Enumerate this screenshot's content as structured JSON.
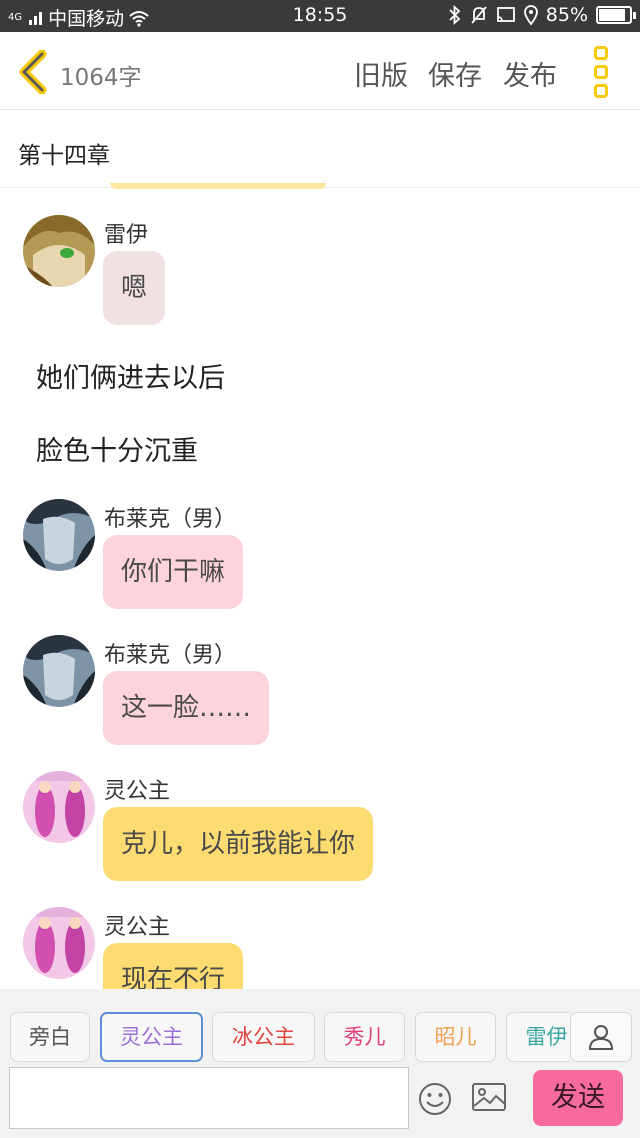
{
  "status_bar": {
    "signal": "4G",
    "carrier": "中国移动",
    "time": "18:55",
    "battery": "85%",
    "battery_level": 0.85
  },
  "header": {
    "word_count": "1064字",
    "old_version": "旧版",
    "save": "保存",
    "publish": "发布"
  },
  "chapter": {
    "title": "第十四章"
  },
  "messages": [
    {
      "type": "dialogue",
      "speaker": "雷伊",
      "text": "嗯",
      "bubble_color": "#f1e1e2"
    },
    {
      "type": "narration",
      "text": "她们俩进去以后"
    },
    {
      "type": "narration",
      "text": "脸色十分沉重"
    },
    {
      "type": "dialogue",
      "speaker": "布莱克（男）",
      "text": "你们干嘛",
      "bubble_color": "#fdd3dc"
    },
    {
      "type": "dialogue",
      "speaker": "布莱克（男）",
      "text": "这一脸……",
      "bubble_color": "#fdd3dc"
    },
    {
      "type": "dialogue",
      "speaker": "灵公主",
      "text": "克儿，以前我能让你",
      "bubble_color": "#fcdc70"
    },
    {
      "type": "dialogue",
      "speaker": "灵公主",
      "text": "现在不行",
      "bubble_color": "#fcdc70"
    }
  ],
  "roles": [
    {
      "name": "旁白",
      "color": "#555555",
      "selected": false
    },
    {
      "name": "灵公主",
      "color": "#9b6fd6",
      "selected": true
    },
    {
      "name": "冰公主",
      "color": "#e0443c",
      "selected": false
    },
    {
      "name": "秀儿",
      "color": "#e0407c",
      "selected": false
    },
    {
      "name": "昭儿",
      "color": "#f0a050",
      "selected": false
    },
    {
      "name": "雷伊",
      "color": "#3ba7a0",
      "selected": false
    }
  ],
  "input": {
    "value": "",
    "placeholder": ""
  },
  "send_label": "发送",
  "icons": {
    "back": "chevron-left-icon",
    "more": "more-vertical-icon",
    "add_role": "person-icon",
    "emoji": "smiley-icon",
    "image": "image-icon"
  }
}
